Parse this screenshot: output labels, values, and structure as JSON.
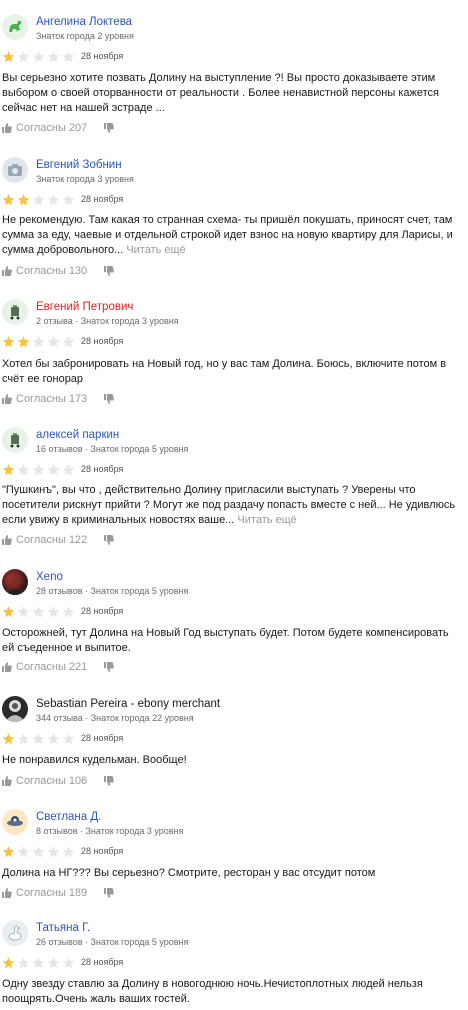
{
  "colors": {
    "star_filled": "#f8c33a",
    "star_empty": "#e6e6e6",
    "author_blue": "#2b56b8",
    "author_red": "#d92121",
    "meta_gray": "#6b6b6b"
  },
  "reviews": [
    {
      "author": "Ангелина Локтева",
      "meta": "Знаток города 2 уровня",
      "rating": 1,
      "date": "28 ноября",
      "text": "Вы серьезно хотите позвать Долину на выступление ?! Вы просто доказываете этим выбором о своей оторванности от реальности . Более ненавистной персоны кажется сейчас нет на нашей эстраде ...",
      "read_more": "",
      "likes": "Согласны 207",
      "avatar_icon": "dinosaur-avatar-icon"
    },
    {
      "author": "Евгений Зобнин",
      "meta": "Знаток города 3 уровня",
      "rating": 2,
      "date": "28 ноября",
      "text": "Не рекомендую. Там какая то странная схема- ты пришёл покушать, приносят счет, там сумма за еду, чаевые и отдельной строкой идет взнос на новую квартиру для Ларисы, и сумма добровольного...",
      "read_more": "Читать ещё",
      "likes": "Согласны 130",
      "avatar_icon": "camera-avatar-icon"
    },
    {
      "author": "Евгений Петрович",
      "meta": "2 отзыва · Знаток города 3 уровня",
      "rating": 2,
      "date": "28 ноября",
      "text": "Хотел бы забронировать на Новый год, но у вас там Долина. Боюсь, включите потом в счёт ее гонорар",
      "read_more": "",
      "likes": "Согласны 173",
      "avatar_icon": "trolley-avatar-icon"
    },
    {
      "author": "алексей паркин",
      "meta": "16 отзывов · Знаток города 5 уровня",
      "rating": 1,
      "date": "28 ноября",
      "text": "\"Пушкинъ\", вы что , действительно Долину пригласили выступать ? Уверены что посетители рискнут прийти ? Могут же под раздачу попасть вместе с ней... Не удивлюсь если увижу в криминальных новостях ваше...",
      "read_more": "Читать ещё",
      "likes": "Согласны 122",
      "avatar_icon": "trolley-avatar-icon"
    },
    {
      "author": "Xeno",
      "meta": "28 отзывов · Знаток города 5 уровня",
      "rating": 1,
      "date": "28 ноября",
      "text": "Осторожней, тут Долина на Новый Год выступать будет. Потом будете компенсировать ей съеденное и выпитое.",
      "read_more": "",
      "likes": "Согласны 221",
      "avatar_icon": "photo-avatar-icon"
    },
    {
      "author": "Sebastian Pereira - ebony merchant",
      "meta": "344 отзыва · Знаток города 22 уровня",
      "rating": 1,
      "date": "28 ноября",
      "text": "Не понравился кудельман. Вообще!",
      "read_more": "",
      "likes": "Согласны 106",
      "avatar_icon": "photo-avatar-icon"
    },
    {
      "author": "Светлана Д.",
      "meta": "8 отзывов · Знаток города 3 уровня",
      "rating": 1,
      "date": "28 ноября",
      "text": "Долина на НГ??? Вы серьезно? Смотрите, ресторан у вас отсудит потом",
      "read_more": "",
      "likes": "Согласны 189",
      "avatar_icon": "ufo-avatar-icon"
    },
    {
      "author": "Татьяна Г.",
      "meta": "26 отзывов · Знаток города 5 уровня",
      "rating": 1,
      "date": "28 ноября",
      "text": "Одну звезду ставлю за Долину в новогоднюю ночь.Нечистоплотных людей нельзя поощрять.Очень жаль ваших гостей.",
      "read_more": "",
      "likes": "",
      "avatar_icon": "goose-avatar-icon"
    }
  ]
}
